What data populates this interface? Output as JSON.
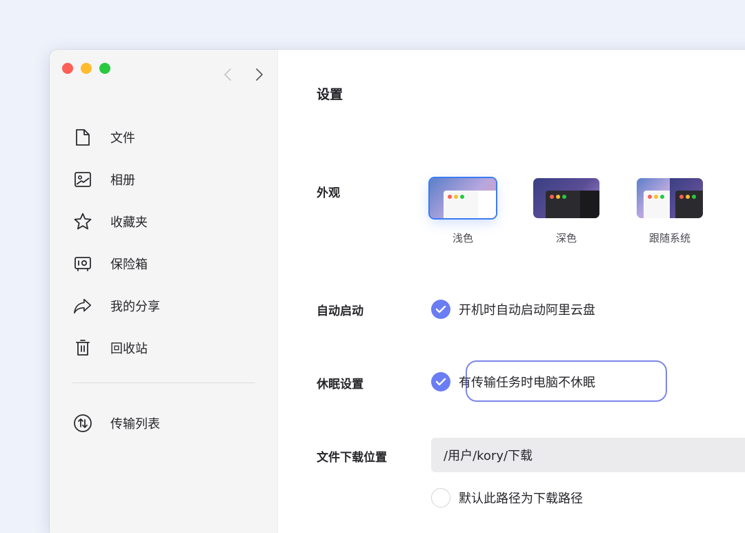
{
  "window": {
    "traffic_lights": {
      "close": "#fe5f57",
      "minimize": "#febc2e",
      "zoom": "#28c840"
    }
  },
  "sidebar": {
    "nav_back_icon": "chevron-left-icon",
    "nav_forward_icon": "chevron-right-icon",
    "items": [
      {
        "label": "文件",
        "icon": "file-icon"
      },
      {
        "label": "相册",
        "icon": "photo-album-icon"
      },
      {
        "label": "收藏夹",
        "icon": "star-icon"
      },
      {
        "label": "保险箱",
        "icon": "safe-icon"
      },
      {
        "label": "我的分享",
        "icon": "share-icon"
      },
      {
        "label": "回收站",
        "icon": "trash-icon"
      }
    ],
    "transfer": {
      "label": "传输列表",
      "icon": "transfer-icon"
    }
  },
  "main": {
    "title": "设置",
    "appearance": {
      "label": "外观",
      "options": [
        {
          "label": "浅色",
          "selected": true
        },
        {
          "label": "深色",
          "selected": false
        },
        {
          "label": "跟随系统",
          "selected": false
        }
      ]
    },
    "auto_start": {
      "label": "自动启动",
      "option": "开机时自动启动阿里云盘",
      "checked": true
    },
    "sleep": {
      "label": "休眠设置",
      "option": "有传输任务时电脑不休眠",
      "checked": true
    },
    "download": {
      "label": "文件下载位置",
      "path": "/用户/kory/下载",
      "default_option": "默认此路径为下载路径",
      "default_checked": false
    }
  },
  "colors": {
    "accent": "#6a7df3",
    "selected_outline": "#3b7bf2",
    "highlight": "#7b86ea"
  }
}
